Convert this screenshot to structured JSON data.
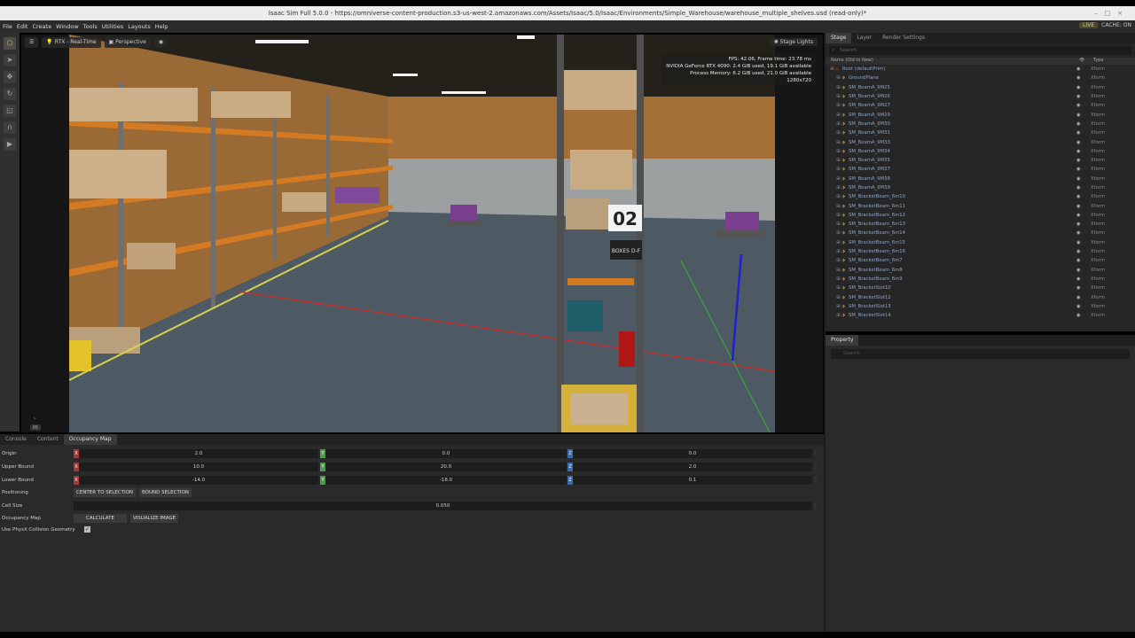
{
  "window": {
    "title": "Isaac Sim Full 5.0.0 - https://omniverse-content-production.s3-us-west-2.amazonaws.com/Assets/Isaac/5.0/Isaac/Environments/Simple_Warehouse/warehouse_multiple_shelves.usd (read-only)*"
  },
  "menubar": {
    "items": [
      "File",
      "Edit",
      "Create",
      "Window",
      "Tools",
      "Utilities",
      "Layouts",
      "Help"
    ],
    "live": "LIVE",
    "cache": "CACHE: ON"
  },
  "viewport": {
    "rtx_mode": "RTX - Real-Time",
    "camera": "Perspective",
    "stage_lights": "Stage Lights",
    "hud": {
      "fps": "FPS: 42.06, Frame time: 23.78 ms",
      "gpu": "NVIDIA GeForce RTX 4090: 2.4 GiB used, 19.1 GiB available",
      "memory": "Process Memory: 6.2 GiB used, 21.0 GiB available",
      "resolution": "1280x720"
    },
    "shelf_sign": "02",
    "boxes_sign": "BOXES D-F",
    "m_badge": "m",
    "colors": {
      "shelf_orange": "#d47a22",
      "floor": "#4d5a63",
      "wall": "#b08048"
    }
  },
  "stage": {
    "tabs": [
      "Stage",
      "Layer",
      "Render Settings"
    ],
    "search_placeholder": "Search",
    "columns": {
      "name": "Name (Old to New)",
      "type": "Type"
    },
    "rows": [
      {
        "name": "Root (defaultPrim)",
        "type": "Xform",
        "level": 0
      },
      {
        "name": "GroundPlane",
        "type": "Xform",
        "level": 1
      },
      {
        "name": "SM_BeamA_9M25",
        "type": "Xform",
        "level": 1
      },
      {
        "name": "SM_BeamA_9M26",
        "type": "Xform",
        "level": 1
      },
      {
        "name": "SM_BeamA_9M27",
        "type": "Xform",
        "level": 1
      },
      {
        "name": "SM_BeamA_9M29",
        "type": "Xform",
        "level": 1
      },
      {
        "name": "SM_BeamA_9M30",
        "type": "Xform",
        "level": 1
      },
      {
        "name": "SM_BeamA_9M31",
        "type": "Xform",
        "level": 1
      },
      {
        "name": "SM_BeamA_9M33",
        "type": "Xform",
        "level": 1
      },
      {
        "name": "SM_BeamA_9M34",
        "type": "Xform",
        "level": 1
      },
      {
        "name": "SM_BeamA_9M35",
        "type": "Xform",
        "level": 1
      },
      {
        "name": "SM_BeamA_9M37",
        "type": "Xform",
        "level": 1
      },
      {
        "name": "SM_BeamA_9M38",
        "type": "Xform",
        "level": 1
      },
      {
        "name": "SM_BeamA_9M39",
        "type": "Xform",
        "level": 1
      },
      {
        "name": "SM_BracketBeam_6m10",
        "type": "Xform",
        "level": 1
      },
      {
        "name": "SM_BracketBeam_6m11",
        "type": "Xform",
        "level": 1
      },
      {
        "name": "SM_BracketBeam_6m12",
        "type": "Xform",
        "level": 1
      },
      {
        "name": "SM_BracketBeam_6m13",
        "type": "Xform",
        "level": 1
      },
      {
        "name": "SM_BracketBeam_6m14",
        "type": "Xform",
        "level": 1
      },
      {
        "name": "SM_BracketBeam_6m15",
        "type": "Xform",
        "level": 1
      },
      {
        "name": "SM_BracketBeam_6m16",
        "type": "Xform",
        "level": 1
      },
      {
        "name": "SM_BracketBeam_6m7",
        "type": "Xform",
        "level": 1
      },
      {
        "name": "SM_BracketBeam_6m8",
        "type": "Xform",
        "level": 1
      },
      {
        "name": "SM_BracketBeam_6m9",
        "type": "Xform",
        "level": 1
      },
      {
        "name": "SM_BracketSlot10",
        "type": "Xform",
        "level": 1
      },
      {
        "name": "SM_BracketSlot12",
        "type": "Xform",
        "level": 1
      },
      {
        "name": "SM_BracketSlot13",
        "type": "Xform",
        "level": 1
      },
      {
        "name": "SM_BracketSlot14",
        "type": "Xform",
        "level": 1
      }
    ]
  },
  "property": {
    "tab": "Property",
    "search_placeholder": "Search"
  },
  "bottom": {
    "tabs": [
      "Console",
      "Content",
      "Occupancy Map"
    ],
    "origin": {
      "label": "Origin",
      "x": "2.0",
      "y": "0.0",
      "z": "0.0"
    },
    "upper": {
      "label": "Upper Bound",
      "x": "10.0",
      "y": "20.0",
      "z": "2.0"
    },
    "lower": {
      "label": "Lower Bound",
      "x": "-14.0",
      "y": "-18.0",
      "z": "0.1"
    },
    "positioning": {
      "label": "Positioning",
      "btn1": "CENTER TO SELECTION",
      "btn2": "BOUND SELECTION"
    },
    "cellsize": {
      "label": "Cell Size",
      "value": "0.050"
    },
    "occmap": {
      "label": "Occupancy Map",
      "btn1": "CALCULATE",
      "btn2": "VISUALIZE IMAGE"
    },
    "physx": {
      "label": "Use PhysX Collision Geometry",
      "checked": "✓"
    },
    "axis_labels": {
      "x": "X",
      "y": "Y",
      "z": "Z"
    }
  }
}
